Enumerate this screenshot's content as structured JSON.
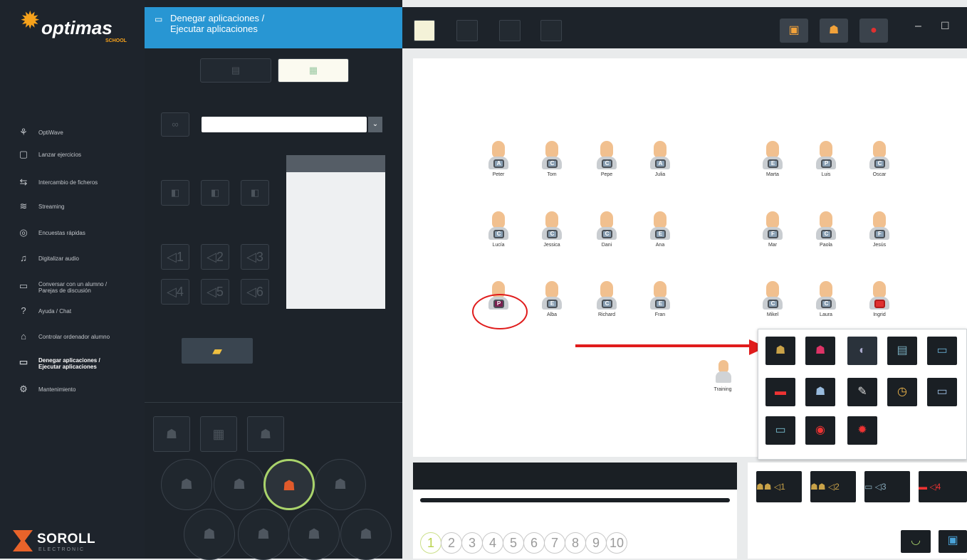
{
  "app": {
    "brand": "optimas",
    "brand_sub": "SCHOOL",
    "vendor": "SOROLL",
    "vendor_sub": "ELECTRONIC"
  },
  "sidebar": {
    "items": [
      {
        "label": "OptiWave",
        "icon": "wave-icon"
      },
      {
        "label": "Lanzar ejercicios",
        "icon": "exercise-icon"
      },
      {
        "label": "Intercambio de ficheros",
        "icon": "exchange-icon"
      },
      {
        "label": "Streaming",
        "icon": "streaming-icon"
      },
      {
        "label": "Encuestas rápidas",
        "icon": "survey-icon"
      },
      {
        "label": "Digitalizar audio",
        "icon": "audio-icon"
      },
      {
        "label": "Conversar con un alumno / Parejas de discusión",
        "icon": "chat-icon"
      },
      {
        "label": "Ayuda / Chat",
        "icon": "help-icon"
      },
      {
        "label": "Controlar ordenador alumno",
        "icon": "control-icon"
      },
      {
        "label": "Denegar aplicaciones / Ejecutar aplicaciones",
        "icon": "apps-icon",
        "active": true
      },
      {
        "label": "Mantenimiento",
        "icon": "maintenance-icon"
      }
    ]
  },
  "panel": {
    "title_line1": "Denegar aplicaciones /",
    "title_line2": "Ejecutar aplicaciones",
    "slots": [
      "1",
      "2",
      "3",
      "4",
      "5",
      "6"
    ]
  },
  "students": [
    {
      "name": "Peter",
      "badge": "A"
    },
    {
      "name": "Tom",
      "badge": "C"
    },
    {
      "name": "Pepe",
      "badge": "C"
    },
    {
      "name": "Julia",
      "badge": "A"
    },
    {
      "name": "Marta",
      "badge": "E"
    },
    {
      "name": "Luis",
      "badge": "P"
    },
    {
      "name": "Oscar",
      "badge": "C"
    },
    {
      "name": "Lucía",
      "badge": "C"
    },
    {
      "name": "Jessica",
      "badge": "C"
    },
    {
      "name": "Dani",
      "badge": "C"
    },
    {
      "name": "Ana",
      "badge": "E"
    },
    {
      "name": "Mar",
      "badge": "F"
    },
    {
      "name": "Paola",
      "badge": "C"
    },
    {
      "name": "Jesús",
      "badge": "F"
    },
    {
      "name": "",
      "badge": "P"
    },
    {
      "name": "Alba",
      "badge": "E"
    },
    {
      "name": "Richard",
      "badge": "C"
    },
    {
      "name": "Fran",
      "badge": "E"
    },
    {
      "name": "Mikel",
      "badge": "C"
    },
    {
      "name": "Laura",
      "badge": "C"
    },
    {
      "name": "Ingrid",
      "badge": ""
    }
  ],
  "teacher": {
    "name": "Training"
  },
  "group_numbers": [
    "1",
    "2",
    "3",
    "4",
    "5",
    "6",
    "7",
    "8",
    "9",
    "10"
  ],
  "quick_slots": [
    "1",
    "2",
    "3",
    "4"
  ],
  "colors": {
    "accent": "#2896d3",
    "sidebar": "#1e242c",
    "annotation": "#e01c1c"
  }
}
